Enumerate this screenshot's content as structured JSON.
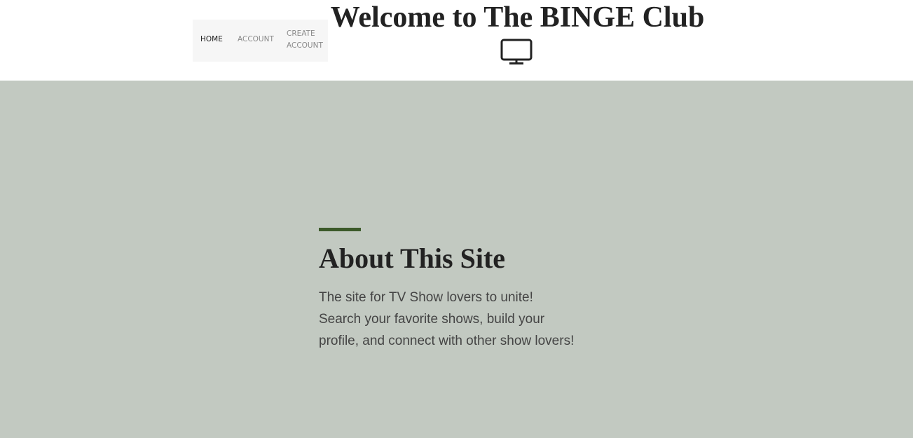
{
  "nav": {
    "items": [
      {
        "label": "HOME"
      },
      {
        "label": "ACCOUNT"
      },
      {
        "label": "CREATE ACCOUNT"
      }
    ]
  },
  "header": {
    "title": "Welcome to The BINGE Club",
    "icon": "tv-monitor-icon"
  },
  "about": {
    "heading": "About This Site",
    "lines": [
      "The site for TV Show lovers to unite!",
      "Search your favorite shows, build your",
      "profile, and connect with other show lovers!"
    ]
  },
  "colors": {
    "hero_background": "#c2c9c1",
    "accent": "#3c5a2a",
    "text_dark": "#222222",
    "nav_background": "#f6f6f6"
  }
}
